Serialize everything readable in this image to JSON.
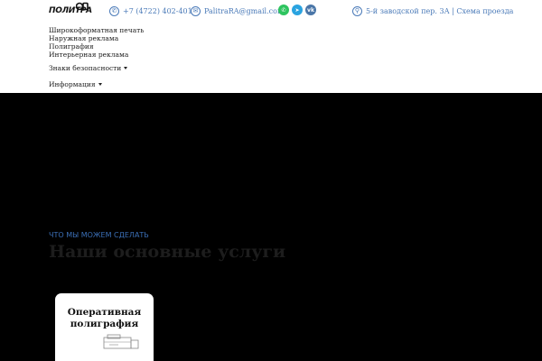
{
  "header": {
    "logo_text": "ПОЛИТРА",
    "phone": "+7 (4722) 402-401",
    "email": "PalitraRA@gmail.com",
    "address": "5-й заводской пер. 3А | Схема проезда",
    "social": [
      {
        "name": "whatsapp",
        "glyph": "✆",
        "color": "#2ec45f"
      },
      {
        "name": "telegram",
        "glyph": "➤",
        "color": "#2aa3e0"
      },
      {
        "name": "vk",
        "glyph": "vk",
        "color": "#4a76a8"
      }
    ]
  },
  "menu": {
    "items": [
      "Широкоформатная печать",
      "Наружная реклама",
      "Полиграфия",
      "Интерьерная реклама"
    ],
    "safety_signs": "Знаки безопасности",
    "info": "Информация"
  },
  "hero": {
    "subtitle": "ЧТО МЫ МОЖЕМ СДЕЛАТЬ",
    "title": "Наши основные услуги"
  },
  "services": [
    {
      "title_line1": "Оперативная",
      "title_line2": "полиграфия",
      "icon": "printer-icon"
    }
  ],
  "colors": {
    "accent": "#4a7ab8",
    "hero_bg": "#000000"
  }
}
